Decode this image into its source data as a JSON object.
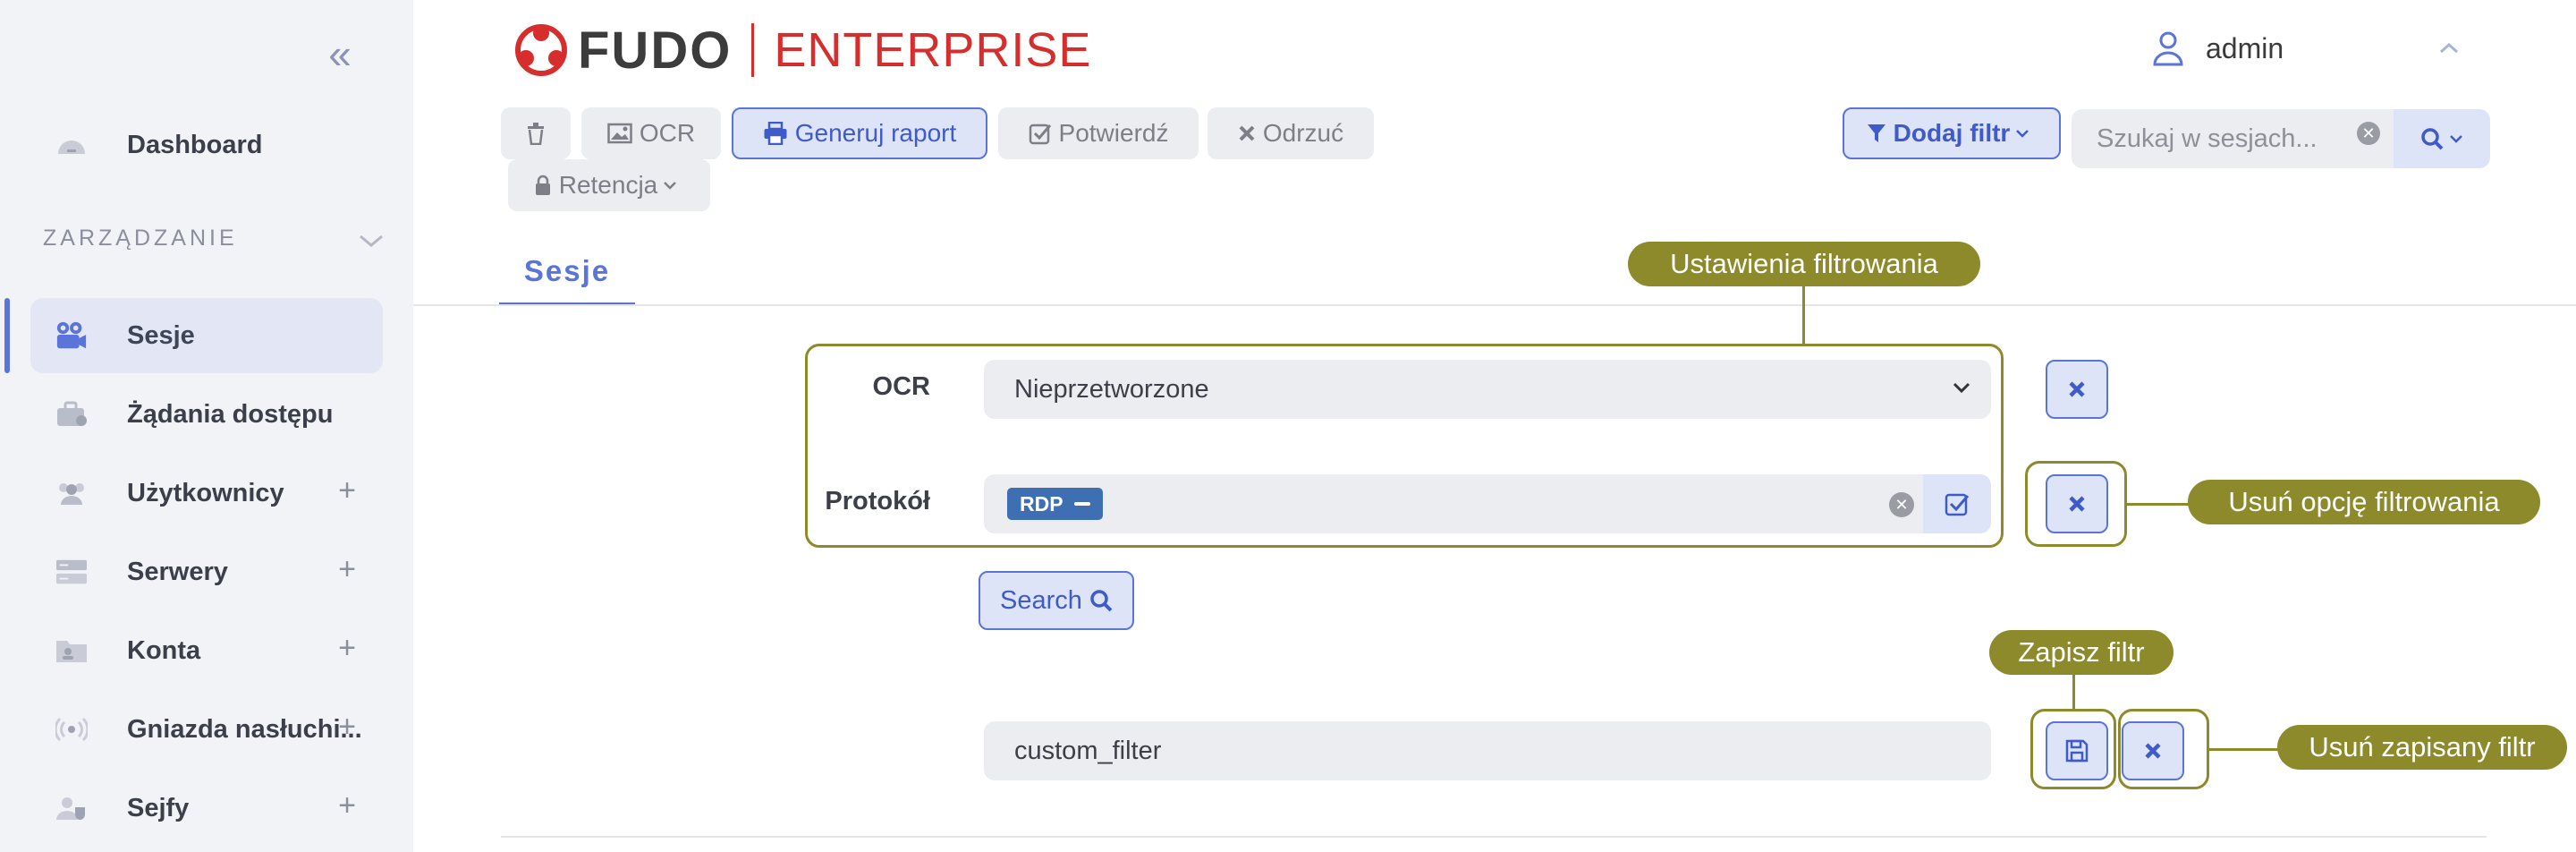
{
  "sidebar": {
    "collapse_glyph": "«",
    "dashboard": "Dashboard",
    "section": "ZARZĄDZANIE",
    "items": [
      {
        "label": "Sesje",
        "icon": "camera-icon"
      },
      {
        "label": "Żądania dostępu",
        "icon": "briefcase-icon"
      },
      {
        "label": "Użytkownicy",
        "icon": "users-icon"
      },
      {
        "label": "Serwery",
        "icon": "server-icon"
      },
      {
        "label": "Konta",
        "icon": "account-folder-icon"
      },
      {
        "label": "Gniazda nasłuchi...",
        "icon": "broadcast-icon"
      },
      {
        "label": "Sejfy",
        "icon": "safe-user-icon"
      }
    ],
    "plus": "+"
  },
  "header": {
    "logo_text": "FUDO",
    "logo_enterprise": "ENTERPRISE",
    "user": "admin"
  },
  "toolbar": {
    "ocr": "OCR",
    "report": "Generuj raport",
    "confirm": "Potwierdź",
    "reject": "Odrzuć",
    "retention": "Retencja",
    "add_filter": "Dodaj filtr",
    "search_placeholder": "Szukaj w sesjach..."
  },
  "tabs": {
    "sessions": "Sesje"
  },
  "filter": {
    "ocr_label": "OCR",
    "ocr_value": "Nieprzetworzone",
    "protocol_label": "Protokół",
    "protocol_tag": "RDP",
    "search_button": "Search",
    "saved_filter_value": "custom_filter"
  },
  "annotations": {
    "filter_settings": "Ustawienia filtrowania",
    "remove_filter_option": "Usuń opcję filtrowania",
    "save_filter": "Zapisz filtr",
    "remove_saved_filter": "Usuń zapisany filtr"
  },
  "colors": {
    "accent": "#5b74d9",
    "annotation": "#8c8a2a",
    "logo_red": "#d62d2d",
    "sidebar_bg": "#f2f3f7"
  }
}
